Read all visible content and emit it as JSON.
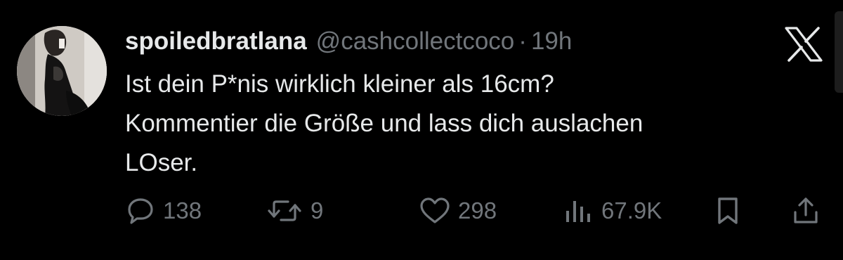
{
  "tweet": {
    "display_name": "spoiledbratlana",
    "handle": "@cashcollectcoco",
    "separator": "·",
    "time": "19h",
    "text_lines": [
      "Ist dein P*nis wirklich kleiner als 16cm?",
      "Kommentier die Größe und lass dich auslachen",
      "LOser."
    ]
  },
  "actions": {
    "reply_count": "138",
    "retweet_count": "9",
    "like_count": "298",
    "views_count": "67.9K"
  },
  "icons": {
    "avatar": "avatar-photo",
    "logo": "x-logo-icon",
    "reply": "reply-icon",
    "retweet": "retweet-icon",
    "like": "heart-icon",
    "views": "views-bar-chart-icon",
    "bookmark": "bookmark-icon",
    "share": "share-icon"
  },
  "colors": {
    "background": "#000000",
    "primary_text": "#e7e9ea",
    "secondary_text": "#71767b"
  }
}
